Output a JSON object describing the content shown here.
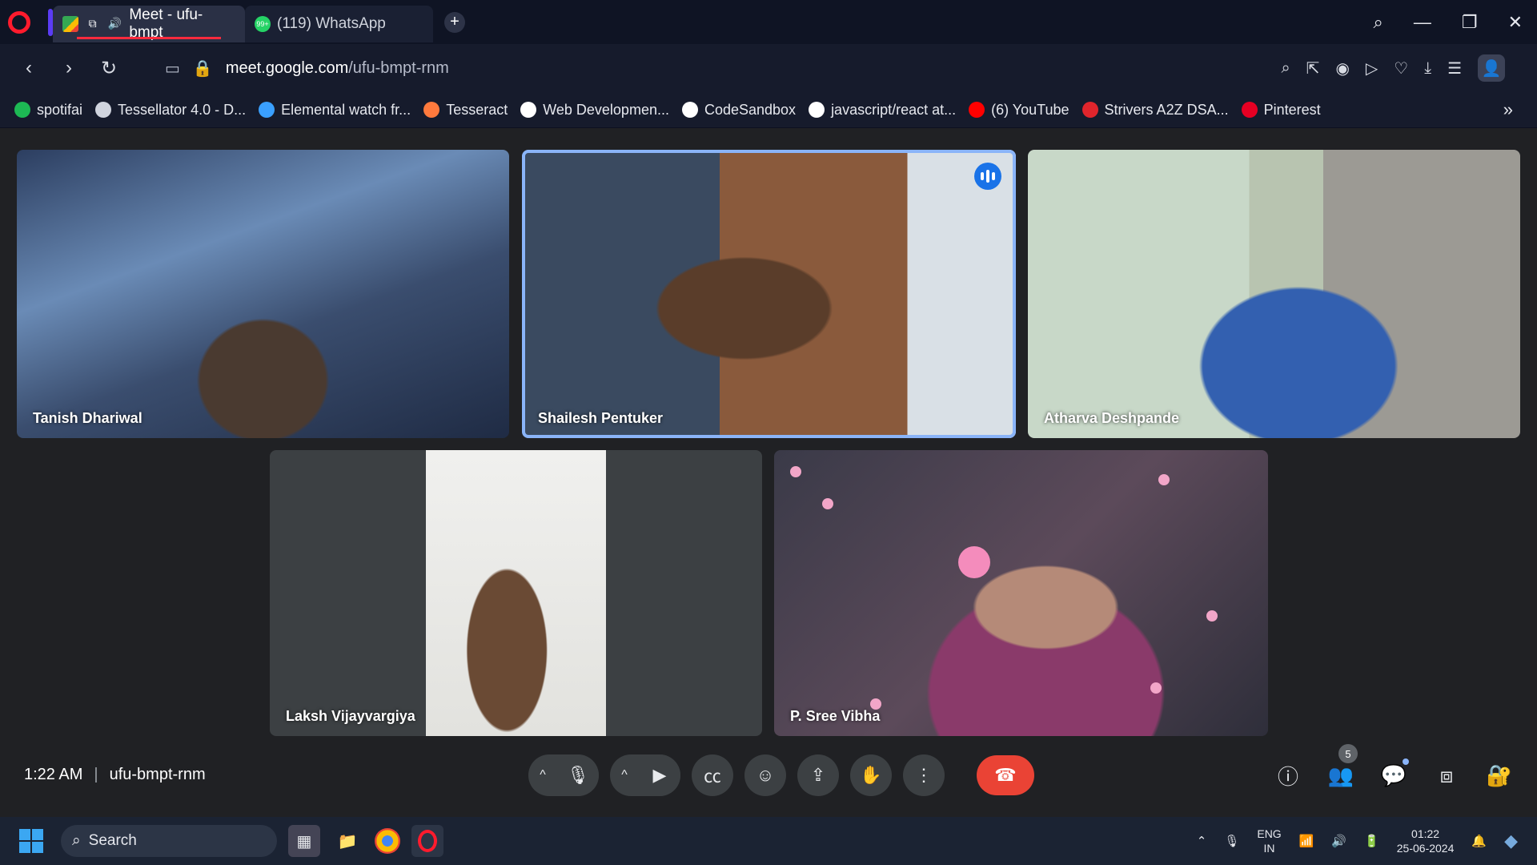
{
  "browser": {
    "tabs": [
      {
        "title": "Meet - ufu-bmpt",
        "active": true
      },
      {
        "title": "(119) WhatsApp",
        "active": false,
        "badge": "99+"
      }
    ],
    "url_host": "meet.google.com",
    "url_path": "/ufu-bmpt-rnm",
    "bookmarks": [
      {
        "label": "spotifai",
        "color": "#1db954"
      },
      {
        "label": "Tessellator 4.0 - D...",
        "color": "#d0d4de"
      },
      {
        "label": "Elemental watch fr...",
        "color": "#3aa0ff"
      },
      {
        "label": "Tesseract",
        "color": "#ff7a3d"
      },
      {
        "label": "Web Developmen...",
        "color": "#ffffff"
      },
      {
        "label": "CodeSandbox",
        "color": "#ffffff"
      },
      {
        "label": "javascript/react at...",
        "color": "#ffffff"
      },
      {
        "label": "(6) YouTube",
        "color": "#ff0000"
      },
      {
        "label": "Strivers A2Z DSA...",
        "color": "#e0252c"
      },
      {
        "label": "Pinterest",
        "color": "#e60023"
      }
    ]
  },
  "meet": {
    "participants": [
      {
        "name": "Tanish Dhariwal",
        "speaking": false
      },
      {
        "name": "Shailesh Pentuker",
        "speaking": true
      },
      {
        "name": "Atharva Deshpande",
        "speaking": false
      },
      {
        "name": "Laksh Vijayvargiya",
        "speaking": false
      },
      {
        "name": "P. Sree Vibha",
        "speaking": false
      }
    ],
    "time": "1:22 AM",
    "meeting_code": "ufu-bmpt-rnm",
    "people_count": "5"
  },
  "taskbar": {
    "search_label": "Search",
    "lang_top": "ENG",
    "lang_bottom": "IN",
    "clock_time": "01:22",
    "clock_date": "25-06-2024"
  },
  "colors": {
    "accent_blue": "#8ab4f8",
    "end_call_red": "#ea4335",
    "meet_bg": "#202124"
  }
}
